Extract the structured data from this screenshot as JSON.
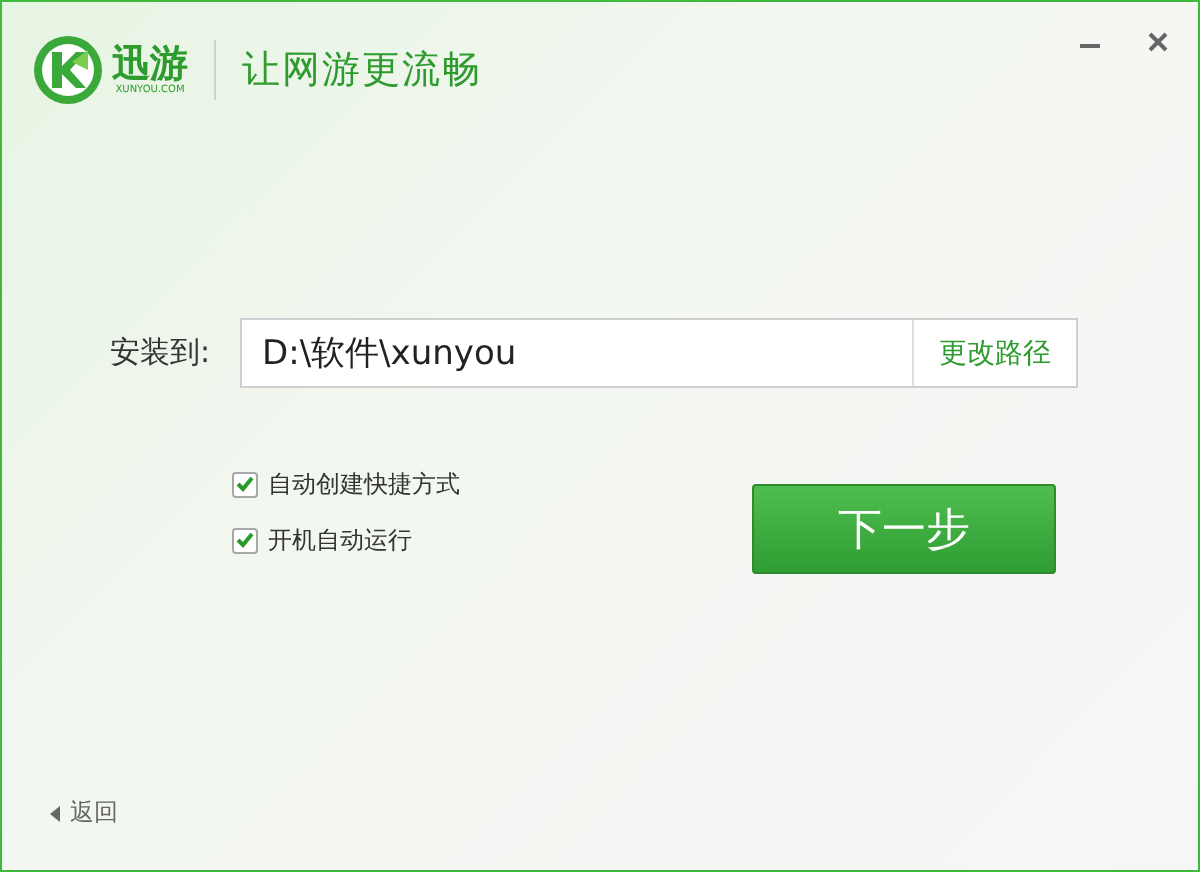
{
  "header": {
    "brand": "迅游",
    "brand_sub": "XUNYOU.COM",
    "slogan": "让网游更流畅"
  },
  "install": {
    "label": "安装到:",
    "path": "D:\\软件\\xunyou",
    "change_button": "更改路径"
  },
  "options": [
    {
      "label": "自动创建快捷方式",
      "checked": true
    },
    {
      "label": "开机自动运行",
      "checked": true
    }
  ],
  "next_button": "下一步",
  "back_link": "返回"
}
